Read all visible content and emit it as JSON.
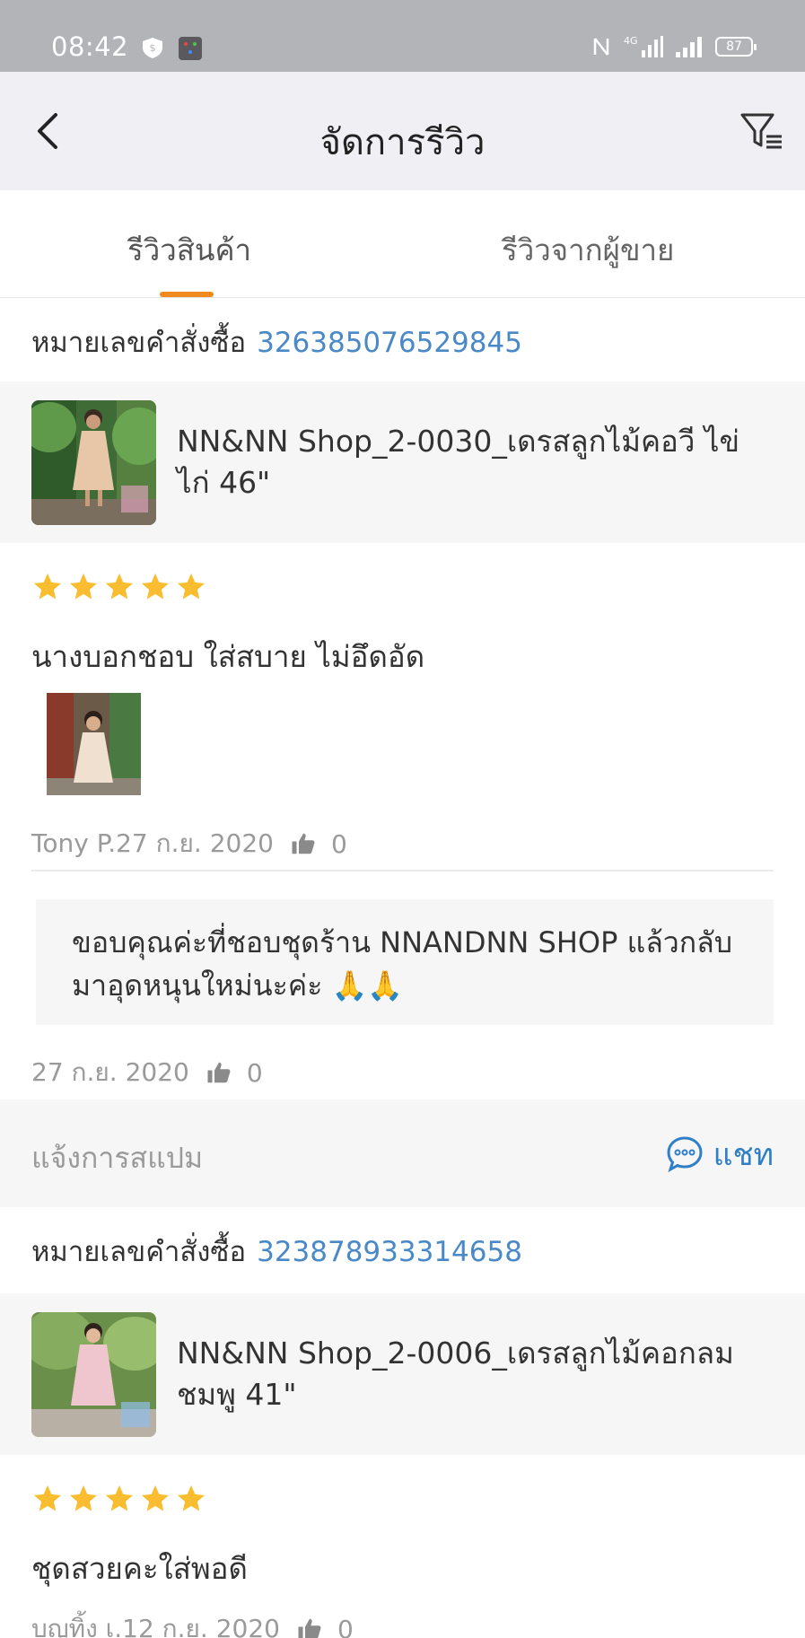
{
  "status_bar": {
    "time": "08:42",
    "network": "4G",
    "battery": "87"
  },
  "header": {
    "title": "จัดการรีวิว",
    "back_icon": "chevron-left-icon",
    "filter_icon": "filter-icon"
  },
  "tabs": [
    {
      "label": "รีวิวสินค้า",
      "active": true
    },
    {
      "label": "รีวิวจากผู้ขาย",
      "active": false
    }
  ],
  "colors": {
    "accent": "#f08a1f",
    "link": "#4a89c8",
    "star": "#f9bd2f",
    "chat": "#2f7fc6"
  },
  "reviews": [
    {
      "order_label": "หมายเลขคำสั่งซื้อ",
      "order_number": "326385076529845",
      "product_name": "NN&NN Shop_2-0030_เดรสลูกไม้คอวี ไข่ไก่ 46\"",
      "rating": 5,
      "text": "นางบอกชอบ ใส่สบาย ไม่อึดอัด",
      "author_date": "Tony P.27 ก.ย. 2020",
      "likes": "0",
      "seller_reply": {
        "text": "ขอบคุณค่ะที่ชอบชุดร้าน NNANDNN SHOP แล้วกลับมาอุดหนุนใหม่นะค่ะ 🙏🙏",
        "date": "27 ก.ย. 2020",
        "likes": "0"
      },
      "report_spam": "แจ้งการสแปม",
      "chat_label": "แชท"
    },
    {
      "order_label": "หมายเลขคำสั่งซื้อ",
      "order_number": "323878933314658",
      "product_name": "NN&NN Shop_2-0006_เดรสลูกไม้คอกลม ชมพู 41\"",
      "rating": 5,
      "text": "ชุดสวยคะใส่พอดี",
      "author_date": "บุญทิ้ง เ.12 ก.ย. 2020",
      "likes": "0"
    }
  ]
}
